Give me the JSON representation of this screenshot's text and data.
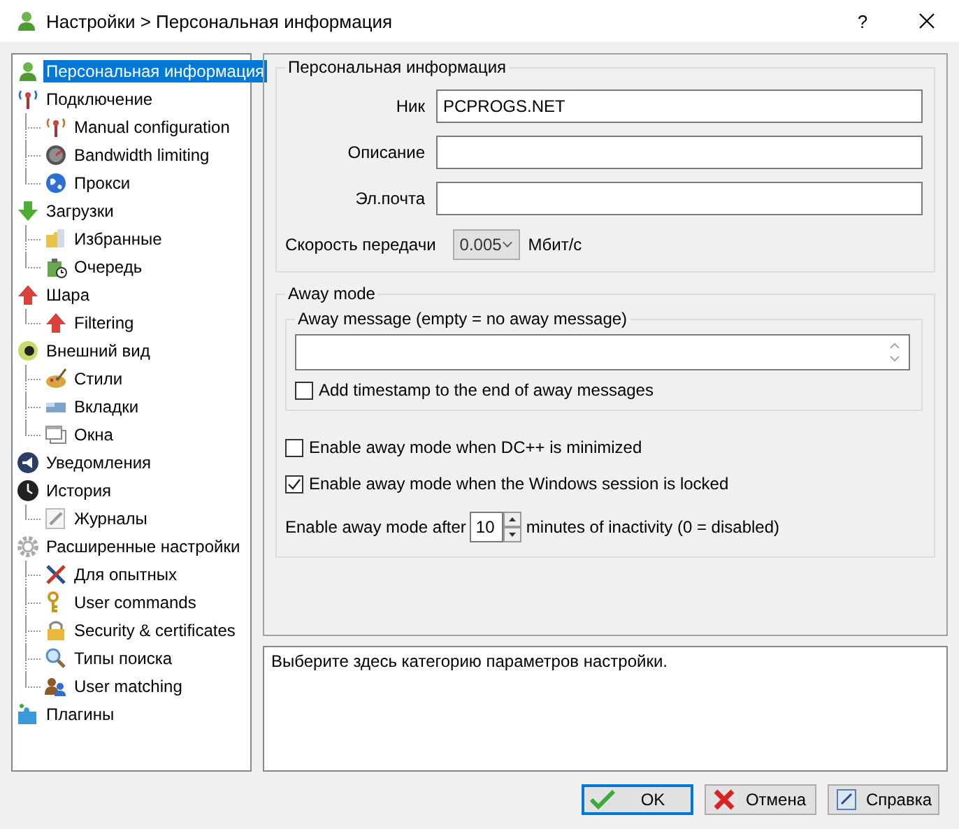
{
  "window": {
    "title": "Настройки > Персональная информация",
    "help": "?"
  },
  "tree": [
    {
      "label": "Персональная информация",
      "selected": true
    },
    {
      "label": "Подключение",
      "selected": false,
      "children": [
        {
          "label": "Manual configuration",
          "selected": false
        },
        {
          "label": "Bandwidth limiting",
          "selected": false
        },
        {
          "label": "Прокси",
          "selected": false
        }
      ]
    },
    {
      "label": "Загрузки",
      "selected": false,
      "children": [
        {
          "label": "Избранные",
          "selected": false
        },
        {
          "label": "Очередь",
          "selected": false
        }
      ]
    },
    {
      "label": "Шара",
      "selected": false,
      "children": [
        {
          "label": "Filtering",
          "selected": false
        }
      ]
    },
    {
      "label": "Внешний вид",
      "selected": false,
      "children": [
        {
          "label": "Стили",
          "selected": false
        },
        {
          "label": "Вкладки",
          "selected": false
        },
        {
          "label": "Окна",
          "selected": false
        }
      ]
    },
    {
      "label": "Уведомления",
      "selected": false
    },
    {
      "label": "История",
      "selected": false,
      "children": [
        {
          "label": "Журналы",
          "selected": false
        }
      ]
    },
    {
      "label": "Расширенные настройки",
      "selected": false,
      "children": [
        {
          "label": "Для опытных",
          "selected": false
        },
        {
          "label": "User commands",
          "selected": false
        },
        {
          "label": "Security & certificates",
          "selected": false
        },
        {
          "label": "Типы поиска",
          "selected": false
        },
        {
          "label": "User matching",
          "selected": false
        }
      ]
    },
    {
      "label": "Плагины",
      "selected": false
    }
  ],
  "personal_info": {
    "title": "Персональная информация",
    "fields": [
      {
        "label": "Ник",
        "value": "PCPROGS.NET"
      },
      {
        "label": "Описание"
      },
      {
        "label": "Эл.почта"
      }
    ],
    "speed": {
      "label": "Скорость передачи",
      "value": "0.005",
      "unit": "Мбит/с"
    }
  },
  "away_mode": {
    "title": "Away mode",
    "message": {
      "title": "Away message (empty = no away message)",
      "timestamp": {
        "label": "Add timestamp to the end of away messages",
        "checked": false
      }
    },
    "options": [
      {
        "label": "Enable away mode when DC++ is minimized",
        "checked": false
      },
      {
        "label": "Enable away mode when the Windows session is locked",
        "checked": true
      }
    ],
    "inactivity": {
      "before": "Enable away mode after",
      "value": "10",
      "after": "minutes of inactivity (0 = disabled)"
    }
  },
  "description": "Выберите здесь категорию параметров настройки.",
  "buttons": [
    {
      "label": "OK",
      "kind": "ok"
    },
    {
      "label": "Отмена",
      "kind": "cancel"
    },
    {
      "label": "Справка",
      "kind": "help"
    }
  ]
}
